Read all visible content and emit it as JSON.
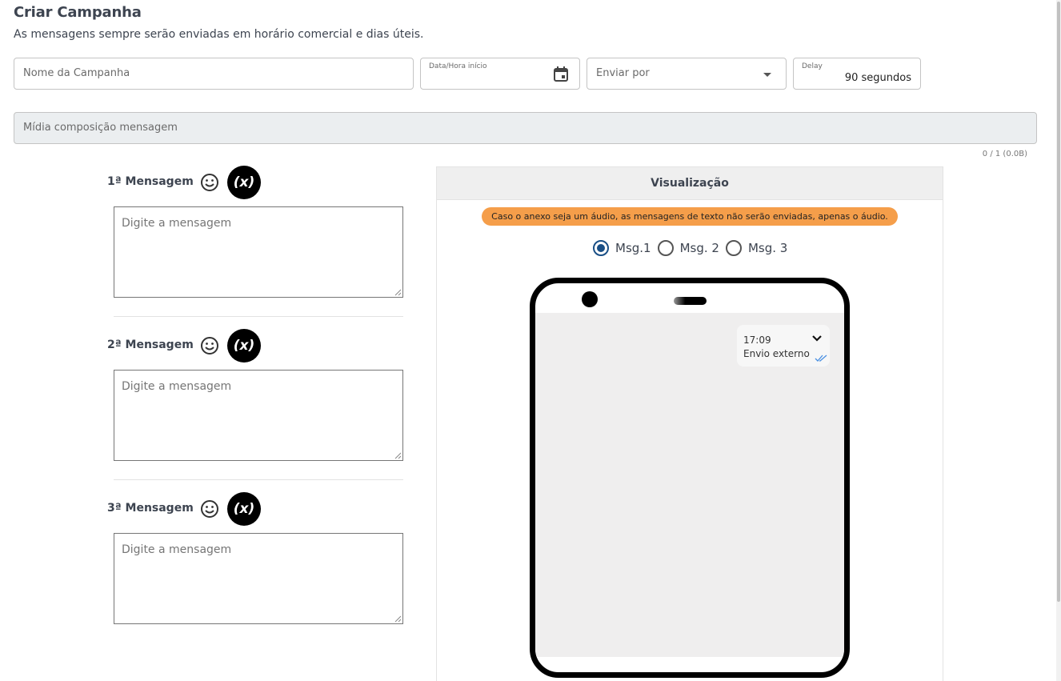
{
  "header": {
    "title": "Criar Campanha",
    "subtitle": "As mensagens sempre serão enviadas em horário comercial e dias úteis."
  },
  "form": {
    "name_placeholder": "Nome da Campanha",
    "date_label": "Data/Hora início",
    "send_by_placeholder": "Enviar por",
    "delay_label": "Delay",
    "delay_value": "90 segundos",
    "media_placeholder": "Mídia composição mensagem",
    "media_counter": "0 / 1 (0.0B)"
  },
  "messages": [
    {
      "label": "1ª Mensagem",
      "placeholder": "Digite a mensagem",
      "variable_button": "(x)"
    },
    {
      "label": "2ª Mensagem",
      "placeholder": "Digite a mensagem",
      "variable_button": "(x)"
    },
    {
      "label": "3ª Mensagem",
      "placeholder": "Digite a mensagem",
      "variable_button": "(x)"
    }
  ],
  "preview": {
    "title": "Visualização",
    "warning": "Caso o anexo seja um áudio, as mensagens de texto não serão enviadas, apenas o áudio.",
    "options": [
      "Msg.1",
      "Msg. 2",
      "Msg. 3"
    ],
    "selected": "Msg.1",
    "bubble": {
      "time": "17:09",
      "text": "Envio externo"
    }
  },
  "colors": {
    "warning_bg": "#f59e4a",
    "radio_selected": "#1a4f86",
    "media_bg": "#ebeef0",
    "phone_screen": "#efeeee",
    "read_ticks": "#4a90e2"
  },
  "icons": [
    "calendar-icon",
    "dropdown-arrow-icon",
    "emoji-icon",
    "variable-icon",
    "chevron-down-icon",
    "double-check-icon"
  ]
}
